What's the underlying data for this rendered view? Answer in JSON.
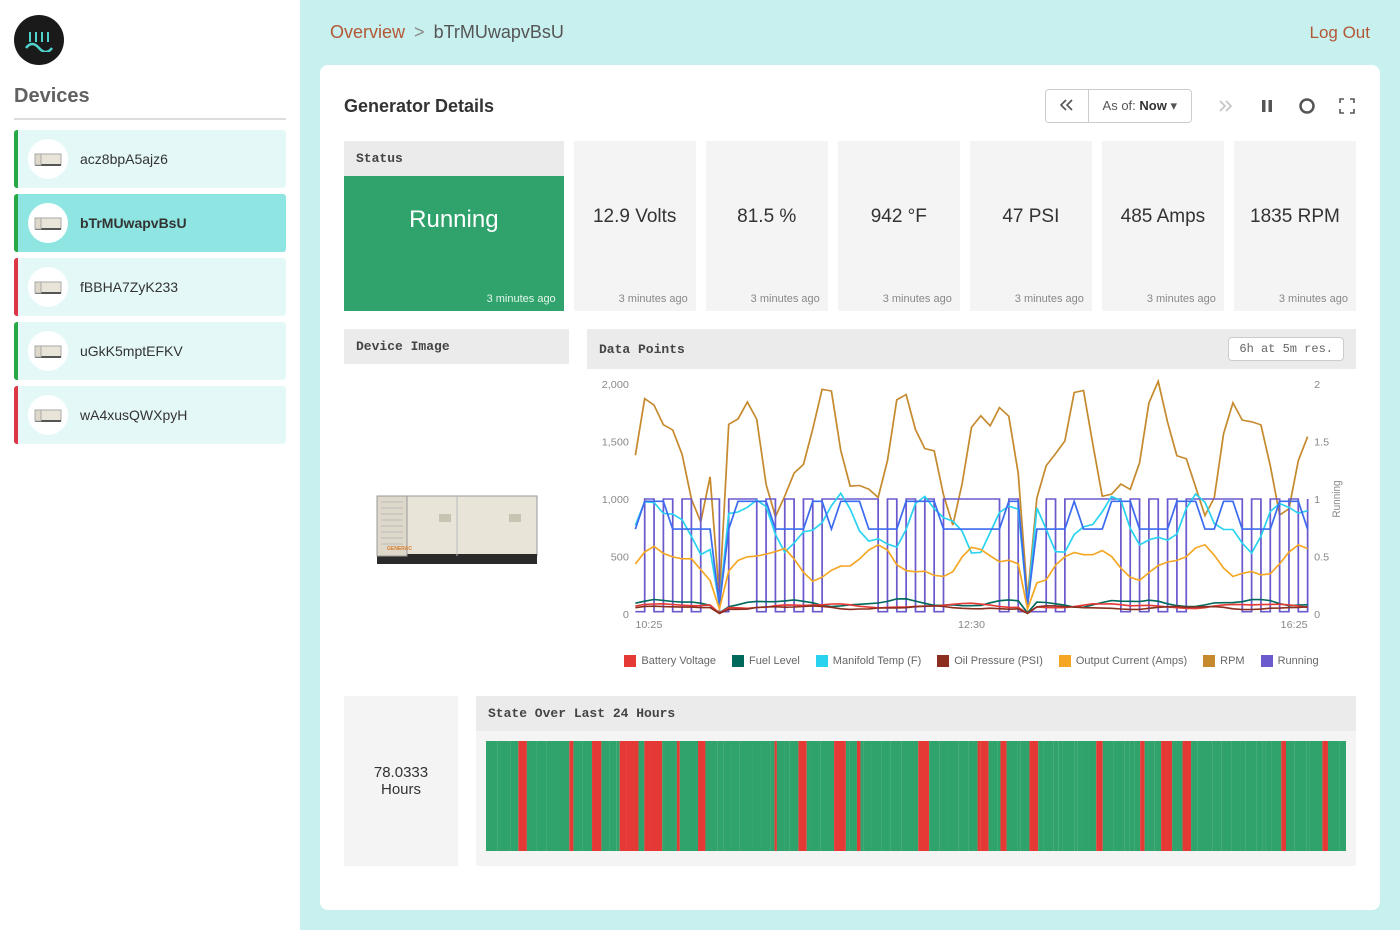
{
  "sidebar": {
    "title": "Devices",
    "devices": [
      {
        "label": "acz8bpA5ajz6",
        "status_color": "green",
        "active": false
      },
      {
        "label": "bTrMUwapvBsU",
        "status_color": "green",
        "active": true
      },
      {
        "label": "fBBHA7ZyK233",
        "status_color": "red",
        "active": false
      },
      {
        "label": "uGkK5mptEFKV",
        "status_color": "green",
        "active": false
      },
      {
        "label": "wA4xusQWXpyH",
        "status_color": "red",
        "active": false
      }
    ]
  },
  "topbar": {
    "breadcrumb_root": "Overview",
    "breadcrumb_sep": ">",
    "breadcrumb_current": "bTrMUwapvBsU",
    "logout": "Log Out"
  },
  "content": {
    "title": "Generator Details",
    "asof_prefix": "As of: ",
    "asof_value": "Now",
    "status": {
      "header": "Status",
      "value": "Running",
      "footer": "3 minutes ago"
    },
    "stats": [
      {
        "value": "12.9 Volts",
        "footer": "3 minutes ago"
      },
      {
        "value": "81.5 %",
        "footer": "3 minutes ago"
      },
      {
        "value": "942 °F",
        "footer": "3 minutes ago"
      },
      {
        "value": "47 PSI",
        "footer": "3 minutes ago"
      },
      {
        "value": "485 Amps",
        "footer": "3 minutes ago"
      },
      {
        "value": "1835 RPM",
        "footer": "3 minutes ago"
      }
    ],
    "device_image_header": "Device Image",
    "datapoints": {
      "header": "Data Points",
      "resolution": "6h at 5m res.",
      "y_left_ticks": [
        "2,000",
        "1,500",
        "1,000",
        "500",
        "0"
      ],
      "y_right_ticks": [
        "2",
        "1.5",
        "1",
        "0.5",
        "0"
      ],
      "y_right_label": "Running",
      "x_ticks": [
        "10:25",
        "12:30",
        "16:25"
      ],
      "legend": [
        {
          "color": "#e53935",
          "label": "Battery Voltage"
        },
        {
          "color": "#00695c",
          "label": "Fuel Level"
        },
        {
          "color": "#29d3f0",
          "label": "Manifold Temp (F)"
        },
        {
          "color": "#8b2e1f",
          "label": "Oil Pressure (PSI)"
        },
        {
          "color": "#f5a623",
          "label": "Output Current (Amps)"
        },
        {
          "color": "#c68a2e",
          "label": "RPM"
        },
        {
          "color": "#6a5acd",
          "label": "Running"
        }
      ]
    },
    "hours": {
      "value": "78.0333",
      "unit": "Hours"
    },
    "state24": {
      "header": "State Over Last 24 Hours"
    }
  },
  "chart_data": {
    "type": "line",
    "title": "Data Points",
    "xlabel": "",
    "ylabel_left": "",
    "ylabel_right": "Running",
    "x_range": [
      "10:25",
      "16:25"
    ],
    "ylim_left": [
      0,
      2000
    ],
    "ylim_right": [
      0,
      2
    ],
    "x_ticks": [
      "10:25",
      "12:30",
      "16:25"
    ],
    "series": [
      {
        "name": "Battery Voltage",
        "color": "#e53935",
        "axis": "left",
        "approx_range": [
          10,
          100
        ]
      },
      {
        "name": "Fuel Level",
        "color": "#00695c",
        "axis": "left",
        "approx_range": [
          60,
          120
        ]
      },
      {
        "name": "Manifold Temp (F)",
        "color": "#29d3f0",
        "axis": "left",
        "approx_range": [
          550,
          1000
        ]
      },
      {
        "name": "Oil Pressure (PSI)",
        "color": "#8b2e1f",
        "axis": "left",
        "approx_range": [
          30,
          70
        ]
      },
      {
        "name": "Output Current (Amps)",
        "color": "#f5a623",
        "axis": "left",
        "approx_range": [
          300,
          600
        ]
      },
      {
        "name": "RPM",
        "color": "#c68a2e",
        "axis": "left",
        "approx_range": [
          900,
          1900
        ]
      },
      {
        "name": "Running",
        "color": "#6a5acd",
        "axis": "right",
        "approx_range": [
          0,
          1
        ]
      }
    ],
    "note": "Oscillating telemetry over 6h window at 5 minute resolution; exact per-point values not labeled in source."
  }
}
